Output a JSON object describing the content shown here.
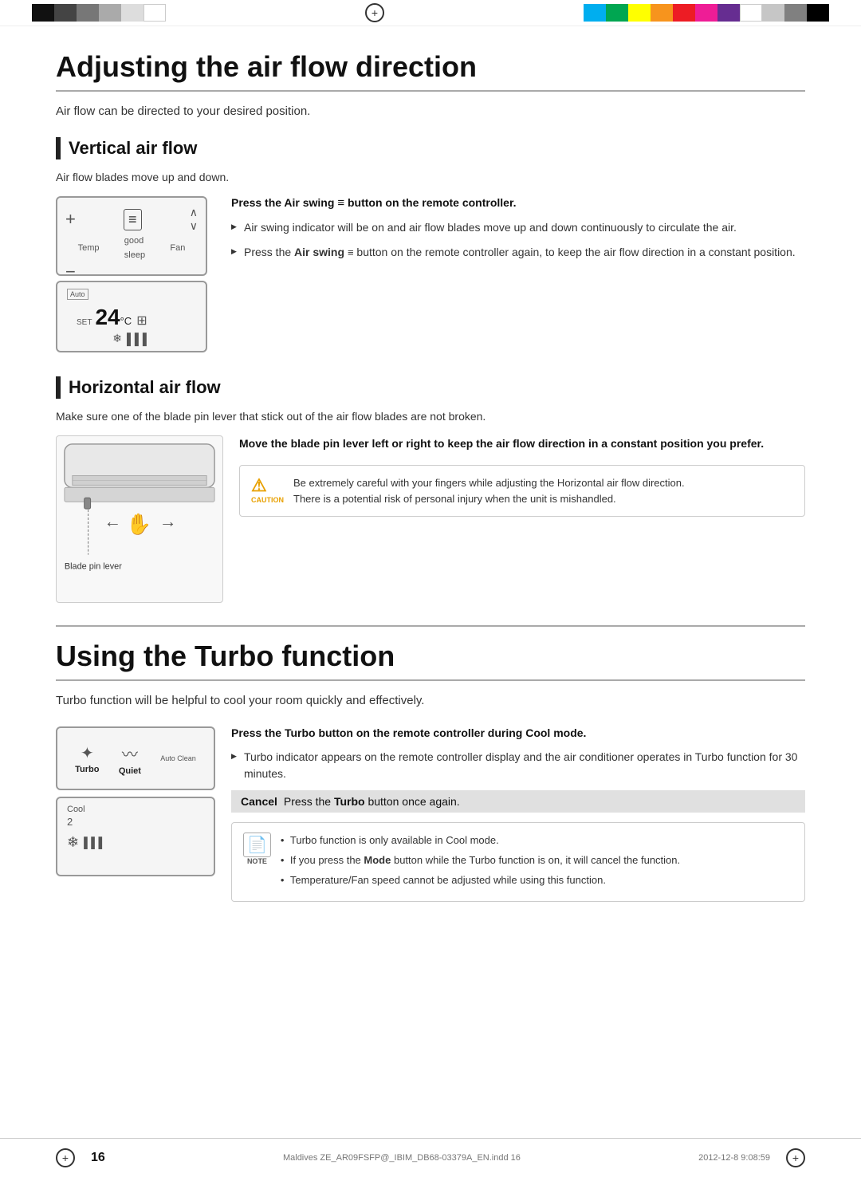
{
  "topBar": {
    "colorSwatchesLeft": [
      "#000000",
      "#333333",
      "#666666",
      "#999999",
      "#cccccc",
      "#ffffff"
    ],
    "colorSwatchesRight": [
      "#00aeef",
      "#00a651",
      "#ffff00",
      "#f7941d",
      "#ed1c24",
      "#ee1d96",
      "#662d91",
      "#ffffff",
      "#c6c6c6",
      "#808080",
      "#000000"
    ]
  },
  "page": {
    "section1": {
      "title": "Adjusting the air flow direction",
      "intro": "Air flow can be directed to your desired position.",
      "subsections": [
        {
          "title": "Vertical air flow",
          "desc": "Air flow blades move up and down.",
          "instruction": "Press the Air swing",
          "instruction_mid": "button on the remote controller.",
          "bullets": [
            "Air swing indicator will be on and air flow blades move up and down continuously to circulate the air.",
            "Press the Air swing button on the remote controller again, to keep the air flow direction in a constant position."
          ],
          "remote_labels": {
            "temp": "Temp",
            "fan": "Fan",
            "good_sleep": "good sleep",
            "auto": "Auto",
            "set": "SET",
            "temp_value": "24",
            "degree": "°C"
          }
        },
        {
          "title": "Horizontal air flow",
          "desc": "Make sure one of the blade pin lever that stick out of the air flow blades are not broken.",
          "move_instruction": "Move the blade pin lever left or right to keep the air flow direction in a constant position you prefer.",
          "blade_pin_label": "Blade pin lever",
          "caution_label": "CAUTION",
          "caution_text": "Be extremely careful with your fingers while adjusting the Horizontal air flow direction.\nThere is a potential risk of personal injury when the unit is mishandled."
        }
      ]
    },
    "section2": {
      "title": "Using the Turbo function",
      "intro": "Turbo function will be helpful to cool your room quickly and effectively.",
      "press_instruction": "Press the Turbo button on the remote controller during Cool mode.",
      "bullets": [
        "Turbo indicator appears on the remote controller display and the air conditioner operates in Turbo function for 30 minutes."
      ],
      "cancel_label": "Cancel",
      "cancel_text": "Press the Turbo button once again.",
      "remote_labels": {
        "turbo": "Turbo",
        "quiet": "Quiet",
        "auto_clean": "Auto Clean",
        "cool_mode": "Cool",
        "num": "2"
      },
      "note_label": "NOTE",
      "notes": [
        "Turbo function is only available in Cool mode.",
        "If you press the Mode button while the Turbo function is on, it will cancel the function.",
        "Temperature/Fan speed cannot be adjusted while using this function."
      ]
    },
    "footer": {
      "page_number": "16",
      "filename": "Maldives ZE_AR09FSFP@_IBIM_DB68-03379A_EN.indd   16",
      "date": "2012-12-8   9:08:59"
    }
  }
}
